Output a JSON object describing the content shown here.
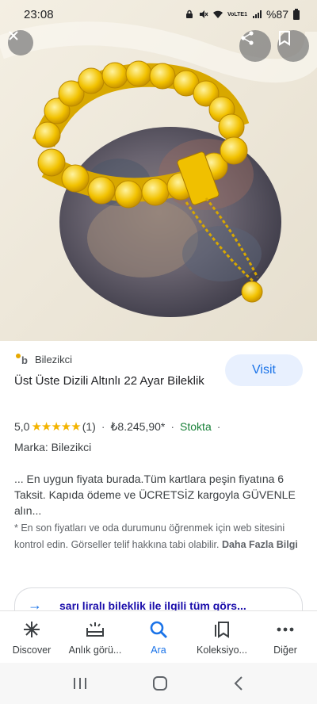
{
  "status_bar": {
    "time": "23:08",
    "network": "VoLTE1",
    "battery": "%87"
  },
  "image_controls": {
    "close_icon": "close-icon",
    "share_icon": "share-icon",
    "bookmark_icon": "bookmark-icon"
  },
  "result": {
    "source_name": "Bilezikci",
    "visit_label": "Visit",
    "title": "Üst Üste Dizili Altınlı 22 Ayar Bileklik",
    "rating_value": "5,0",
    "stars": "★★★★★",
    "review_count": "(1)",
    "price": "₺8.245,90*",
    "stock": "Stokta",
    "brand": "Marka: Bilezikci",
    "description": "... En uygun fiyata burada.Tüm kartlara peşin fiyatına 6 Taksit. Kapıda ödeme ve ÜCRETSİZ kargoyla GÜVENLE alın...",
    "note_text": "* En son fiyatları ve oda durumunu öğrenmek için web sitesini kontrol edin. Görseller telif hakkına tabi olabilir.",
    "note_link": "Daha Fazla Bilgi"
  },
  "related": {
    "label": "sarı liralı bileklik ile ilgili tüm görs..."
  },
  "bottom_nav": [
    {
      "label": "Discover",
      "icon": "asterisk-icon"
    },
    {
      "label": "Anlık görü...",
      "icon": "snapshot-icon"
    },
    {
      "label": "Ara",
      "icon": "search-icon"
    },
    {
      "label": "Koleksiyo...",
      "icon": "collections-icon"
    },
    {
      "label": "Diğer",
      "icon": "more-icon"
    }
  ],
  "colors": {
    "accent": "#1a73e8",
    "stock_green": "#188038",
    "star_gold": "#f4b400"
  }
}
